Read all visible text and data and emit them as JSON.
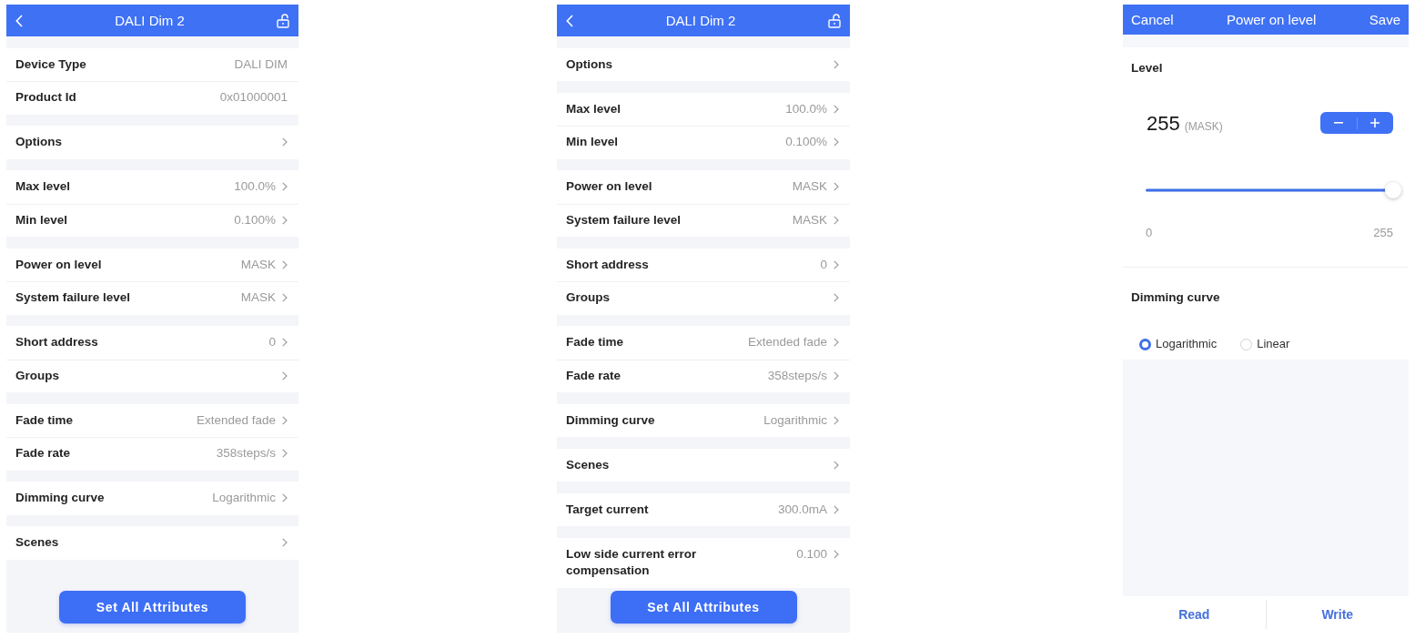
{
  "screens": [
    {
      "kind": "attribute_list",
      "header": {
        "title": "DALI Dim 2"
      },
      "groups": [
        [
          {
            "label": "Device Type",
            "value": "DALI DIM",
            "kind": "info"
          },
          {
            "label": "Product Id",
            "value": "0x01000001",
            "kind": "info"
          }
        ],
        [
          {
            "label": "Options",
            "kind": "link"
          }
        ],
        [
          {
            "label": "Max level",
            "value": "100.0%",
            "kind": "link"
          },
          {
            "label": "Min level",
            "value": "0.100%",
            "kind": "link"
          }
        ],
        [
          {
            "label": "Power on level",
            "value": "MASK",
            "kind": "link"
          },
          {
            "label": "System failure level",
            "value": "MASK",
            "kind": "link"
          }
        ],
        [
          {
            "label": "Short address",
            "value": "0",
            "kind": "link"
          },
          {
            "label": "Groups",
            "kind": "link"
          }
        ],
        [
          {
            "label": "Fade time",
            "value": "Extended fade",
            "kind": "link"
          },
          {
            "label": "Fade rate",
            "value": "358steps/s",
            "kind": "link"
          }
        ],
        [
          {
            "label": "Dimming curve",
            "value": "Logarithmic",
            "kind": "link"
          }
        ],
        [
          {
            "label": "Scenes",
            "kind": "link"
          }
        ]
      ],
      "action_button": "Set All Attributes"
    },
    {
      "kind": "attribute_list",
      "header": {
        "title": "DALI Dim 2"
      },
      "groups": [
        [
          {
            "label": "Options",
            "kind": "link"
          }
        ],
        [
          {
            "label": "Max level",
            "value": "100.0%",
            "kind": "link"
          },
          {
            "label": "Min level",
            "value": "0.100%",
            "kind": "link"
          }
        ],
        [
          {
            "label": "Power on level",
            "value": "MASK",
            "kind": "link"
          },
          {
            "label": "System failure level",
            "value": "MASK",
            "kind": "link"
          }
        ],
        [
          {
            "label": "Short address",
            "value": "0",
            "kind": "link"
          },
          {
            "label": "Groups",
            "kind": "link"
          }
        ],
        [
          {
            "label": "Fade time",
            "value": "Extended fade",
            "kind": "link"
          },
          {
            "label": "Fade rate",
            "value": "358steps/s",
            "kind": "link"
          }
        ],
        [
          {
            "label": "Dimming curve",
            "value": "Logarithmic",
            "kind": "link"
          }
        ],
        [
          {
            "label": "Scenes",
            "kind": "link"
          }
        ],
        [
          {
            "label": "Target current",
            "value": "300.0mA",
            "kind": "link"
          }
        ],
        [
          {
            "label": "Low side current error compensation",
            "value": "0.100",
            "kind": "link"
          }
        ]
      ],
      "action_button": "Set All Attributes"
    },
    {
      "kind": "level_editor",
      "header": {
        "cancel": "Cancel",
        "title": "Power on level",
        "save": "Save"
      },
      "level_section": {
        "label": "Level",
        "value": "255",
        "note": "(MASK)",
        "slider": {
          "level": 1
        },
        "min_label": "0",
        "max_label": "255"
      },
      "curve_section": {
        "label": "Dimming curve",
        "options": [
          {
            "label": "Logarithmic",
            "selected": true
          },
          {
            "label": "Linear",
            "selected": false
          }
        ]
      },
      "footer_buttons": [
        "Read",
        "Write"
      ]
    }
  ]
}
